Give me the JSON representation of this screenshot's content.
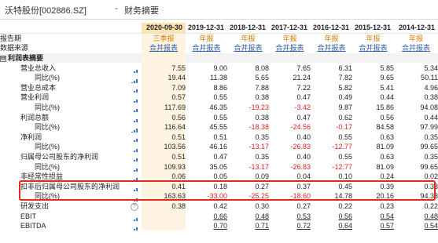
{
  "header": {
    "stock": "沃特股份[002886.SZ]",
    "separator": "-",
    "page": "财务摘要"
  },
  "periods": [
    "2020-09-30",
    "2019-12-31",
    "2018-12-31",
    "2017-12-31",
    "2016-12-31",
    "2015-12-31",
    "2014-12-31"
  ],
  "colors": {
    "accent": "#e07a00",
    "negative": "#e0201b",
    "highlight_border": "#e8261c",
    "current_period_bg": "#fde2b2",
    "link": "#2f5ea8"
  },
  "rows": [
    {
      "label": "报告期",
      "indent": 0,
      "style": "type",
      "values": [
        "三季报",
        "年报",
        "年报",
        "年报",
        "年报",
        "年报",
        "年报"
      ]
    },
    {
      "label": "数据来源",
      "indent": 0,
      "style": "source",
      "values": [
        "合并报表",
        "合并报表",
        "合并报表",
        "合并报表",
        "合并报表",
        "合并报表",
        "合并报表"
      ]
    },
    {
      "label": "利润表摘要",
      "indent": 0,
      "style": "section",
      "collapse": "⊟",
      "values": [
        "",
        "",
        "",
        "",
        "",
        "",
        ""
      ]
    },
    {
      "label": "营业总收入",
      "indent": 1,
      "icon": true,
      "values": [
        "7.55",
        "9.00",
        "8.08",
        "7.65",
        "6.31",
        "5.85",
        "5.34"
      ]
    },
    {
      "label": "同比(%)",
      "indent": 2,
      "icon": true,
      "values": [
        "19.44",
        "11.38",
        "5.65",
        "21.24",
        "7.82",
        "9.65",
        "50.11"
      ]
    },
    {
      "label": "营业总成本",
      "indent": 1,
      "icon": true,
      "values": [
        "7.09",
        "8.86",
        "7.88",
        "7.22",
        "5.82",
        "5.41",
        "4.96"
      ]
    },
    {
      "label": "营业利润",
      "indent": 1,
      "icon": true,
      "values": [
        "0.57",
        "0.55",
        "0.38",
        "0.47",
        "0.49",
        "0.44",
        "0.38"
      ]
    },
    {
      "label": "同比(%)",
      "indent": 2,
      "icon": true,
      "values": [
        "117.69",
        "46.35",
        "-19.23",
        "-3.42",
        "9.87",
        "15.86",
        "94.08"
      ]
    },
    {
      "label": "利润总额",
      "indent": 1,
      "icon": true,
      "values": [
        "0.56",
        "0.55",
        "0.38",
        "0.47",
        "0.62",
        "0.56",
        "0.44"
      ]
    },
    {
      "label": "同比(%)",
      "indent": 2,
      "icon": true,
      "values": [
        "116.64",
        "45.55",
        "-18.38",
        "-24.56",
        "-0.17",
        "84.58",
        "97.99"
      ]
    },
    {
      "label": "净利润",
      "indent": 1,
      "icon": true,
      "values": [
        "0.51",
        "0.51",
        "0.35",
        "0.40",
        "0.55",
        "0.63",
        "0.35"
      ]
    },
    {
      "label": "同比(%)",
      "indent": 2,
      "icon": true,
      "values": [
        "103.56",
        "46.16",
        "-13.17",
        "-26.83",
        "-12.77",
        "81.09",
        "99.65"
      ]
    },
    {
      "label": "归属母公司股东的净利润",
      "indent": 1,
      "icon": true,
      "values": [
        "0.51",
        "0.47",
        "0.35",
        "0.40",
        "0.55",
        "0.63",
        "0.35"
      ]
    },
    {
      "label": "同比(%)",
      "indent": 2,
      "icon": true,
      "values": [
        "109.93",
        "35.05",
        "-13.17",
        "-26.83",
        "-12.77",
        "81.09",
        "99.65"
      ]
    },
    {
      "label": "非经常性损益",
      "indent": 1,
      "icon": true,
      "values": [
        "0.06",
        "0.05",
        "0.09",
        "0.04",
        "0.10",
        "0.24",
        "0.02"
      ]
    },
    {
      "label": "扣非后归属母公司股东的净利润",
      "indent": 1,
      "icon": true,
      "values": [
        "0.41",
        "0.18",
        "0.27",
        "0.37",
        "0.45",
        "0.39",
        "0.33"
      ]
    },
    {
      "label": "同比(%)",
      "indent": 2,
      "icon": true,
      "values": [
        "163.63",
        "-33.00",
        "-25.25",
        "-18.60",
        "14.78",
        "20.16",
        "94.33"
      ]
    },
    {
      "label": "研发支出",
      "indent": 1,
      "icon": true,
      "help": "?",
      "values": [
        "0.38",
        "0.42",
        "0.30",
        "0.27",
        "0.22",
        "0.23",
        "0.22"
      ]
    },
    {
      "label": "EBIT",
      "indent": 1,
      "icon": true,
      "underline": true,
      "values": [
        "",
        "0.66",
        "0.48",
        "0.53",
        "0.56",
        "0.54",
        "0.48"
      ]
    },
    {
      "label": "EBITDA",
      "indent": 1,
      "icon": true,
      "underline": true,
      "values": [
        "",
        "0.70",
        "0.71",
        "0.72",
        "0.64",
        "0.57",
        "0.54"
      ]
    }
  ]
}
